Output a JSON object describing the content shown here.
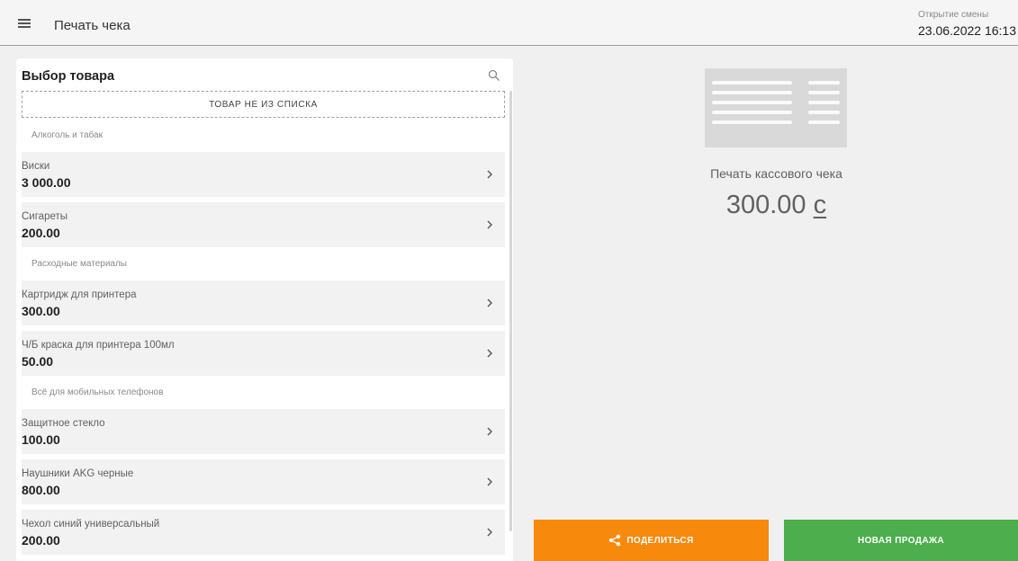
{
  "header": {
    "title": "Печать чека",
    "shift_label": "Открытие смены",
    "shift_date": "23.06.2022 16:13"
  },
  "product_panel": {
    "title": "Выбор товара",
    "custom_item_label": "ТОВАР НЕ ИЗ СПИСКА",
    "categories": [
      {
        "name": "Алкоголь и табак",
        "products": [
          {
            "name": "Виски",
            "price": "3 000.00"
          },
          {
            "name": "Сигареты",
            "price": "200.00"
          }
        ]
      },
      {
        "name": "Расходные материалы",
        "products": [
          {
            "name": "Картридж для принтера",
            "price": "300.00"
          },
          {
            "name": "Ч/Б краска для принтера 100мл",
            "price": "50.00"
          }
        ]
      },
      {
        "name": "Всё для мобильных телефонов",
        "products": [
          {
            "name": "Защитное стекло",
            "price": "100.00"
          },
          {
            "name": "Наушники AKG черные",
            "price": "800.00"
          },
          {
            "name": "Чехол синий универсальный",
            "price": "200.00"
          }
        ]
      }
    ]
  },
  "receipt": {
    "label": "Печать кассового чека",
    "amount": "300.00",
    "currency": "с"
  },
  "actions": {
    "share_label": "ПОДЕЛИТЬСЯ",
    "new_sale_label": "НОВАЯ ПРОДАЖА"
  },
  "colors": {
    "share": "#f7890c",
    "new_sale": "#4cae4c"
  },
  "icons": {
    "menu": "menu-icon",
    "search": "search-icon",
    "chevron": "chevron-right-icon",
    "share": "share-icon",
    "receipt": "receipt-icon"
  }
}
